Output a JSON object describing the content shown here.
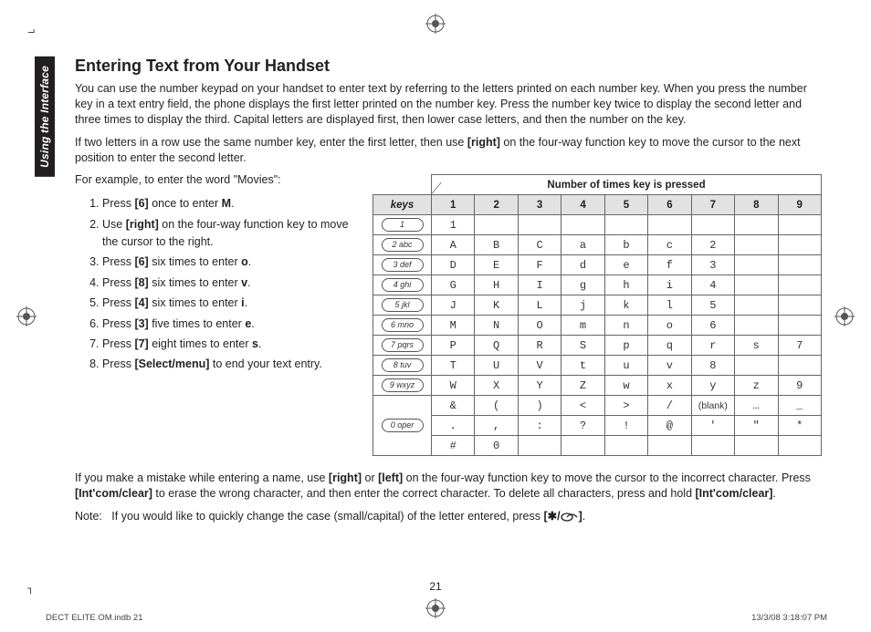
{
  "tab": "Using the Interface",
  "heading": "Entering Text from Your Handset",
  "para1_a": "You can use the number keypad on your handset to enter text by referring to the letters printed on each number key. When you press the number key in a text entry field, the phone displays the first letter printed on the number key. Press the number key twice to display the second letter and three times to display the third. Capital letters are displayed first, then lower case letters, and then the number on the key.",
  "para2_pre": "If two letters in a row use the same number key, enter the first letter, then use ",
  "para2_b1": "[right]",
  "para2_post": " on the four-way function key to move the cursor to the next position to enter the second letter.",
  "example_intro": "For example, to enter the word \"Movies\":",
  "steps": [
    {
      "pre": "Press ",
      "b": "[6]",
      "post": " once to enter ",
      "b2": "M",
      "post2": "."
    },
    {
      "pre": "Use ",
      "b": "[right]",
      "post": " on the four-way function key to move the cursor to the right."
    },
    {
      "pre": "Press ",
      "b": "[6]",
      "post": " six times to enter ",
      "b2": "o",
      "post2": "."
    },
    {
      "pre": "Press ",
      "b": "[8]",
      "post": " six times to enter ",
      "b2": "v",
      "post2": "."
    },
    {
      "pre": "Press ",
      "b": "[4]",
      "post": " six times to enter ",
      "b2": "i",
      "post2": "."
    },
    {
      "pre": "Press ",
      "b": "[3]",
      "post": " five times to enter ",
      "b2": "e",
      "post2": "."
    },
    {
      "pre": "Press ",
      "b": "[7]",
      "post": " eight times to enter ",
      "b2": "s",
      "post2": "."
    },
    {
      "pre": "Press ",
      "b": "[Select/menu]",
      "post": " to end your text entry."
    }
  ],
  "table": {
    "title": "Number of times key is pressed",
    "keys_header": "keys",
    "cols": [
      "1",
      "2",
      "3",
      "4",
      "5",
      "6",
      "7",
      "8",
      "9"
    ],
    "rows": [
      {
        "key": "1",
        "cells": [
          "1",
          "",
          "",
          "",
          "",
          "",
          "",
          "",
          ""
        ]
      },
      {
        "key": "2 abc",
        "cells": [
          "A",
          "B",
          "C",
          "a",
          "b",
          "c",
          "2",
          "",
          ""
        ]
      },
      {
        "key": "3 def",
        "cells": [
          "D",
          "E",
          "F",
          "d",
          "e",
          "f",
          "3",
          "",
          ""
        ]
      },
      {
        "key": "4 ghi",
        "cells": [
          "G",
          "H",
          "I",
          "g",
          "h",
          "i",
          "4",
          "",
          ""
        ]
      },
      {
        "key": "5 jkl",
        "cells": [
          "J",
          "K",
          "L",
          "j",
          "k",
          "l",
          "5",
          "",
          ""
        ]
      },
      {
        "key": "6 mno",
        "cells": [
          "M",
          "N",
          "O",
          "m",
          "n",
          "o",
          "6",
          "",
          ""
        ]
      },
      {
        "key": "7 pqrs",
        "cells": [
          "P",
          "Q",
          "R",
          "S",
          "p",
          "q",
          "r",
          "s",
          "7"
        ]
      },
      {
        "key": "8 tuv",
        "cells": [
          "T",
          "U",
          "V",
          "t",
          "u",
          "v",
          "8",
          "",
          ""
        ]
      },
      {
        "key": "9 wxyz",
        "cells": [
          "W",
          "X",
          "Y",
          "Z",
          "w",
          "x",
          "y",
          "z",
          "9"
        ]
      },
      {
        "key": "",
        "cells": [
          "&",
          "(",
          ")",
          "<",
          ">",
          "/",
          "(blank)",
          "…",
          "_"
        ]
      },
      {
        "key": "0 oper",
        "cells": [
          ".",
          ",",
          ":",
          "?",
          "!",
          "@",
          "'",
          "\"",
          "*"
        ]
      },
      {
        "key": "",
        "cells": [
          "#",
          "0",
          "",
          "",
          "",
          "",
          "",
          "",
          ""
        ]
      }
    ]
  },
  "mistake_parts": {
    "p1": "If you make a mistake while entering a name, use ",
    "b1": "[right]",
    "p2": " or ",
    "b2": "[left]",
    "p3": " on the four-way function key to move the cursor to the incorrect character. Press ",
    "b3": "[Int'com/clear]",
    "p4": " to erase the wrong character, and then enter the correct character. To delete all characters, press and hold ",
    "b4": "[Int'com/clear]",
    "p5": "."
  },
  "note_pre": "Note:   If you would like to quickly change the case (small/capital) of the letter entered, press ",
  "note_b_open": "[",
  "note_star": "✱",
  "note_slash": "/",
  "note_b_close": "]",
  "note_post": ".",
  "pagenum": "21",
  "footer_left": "DECT ELITE OM.indb   21",
  "footer_right": "13/3/08   3:18:07 PM"
}
